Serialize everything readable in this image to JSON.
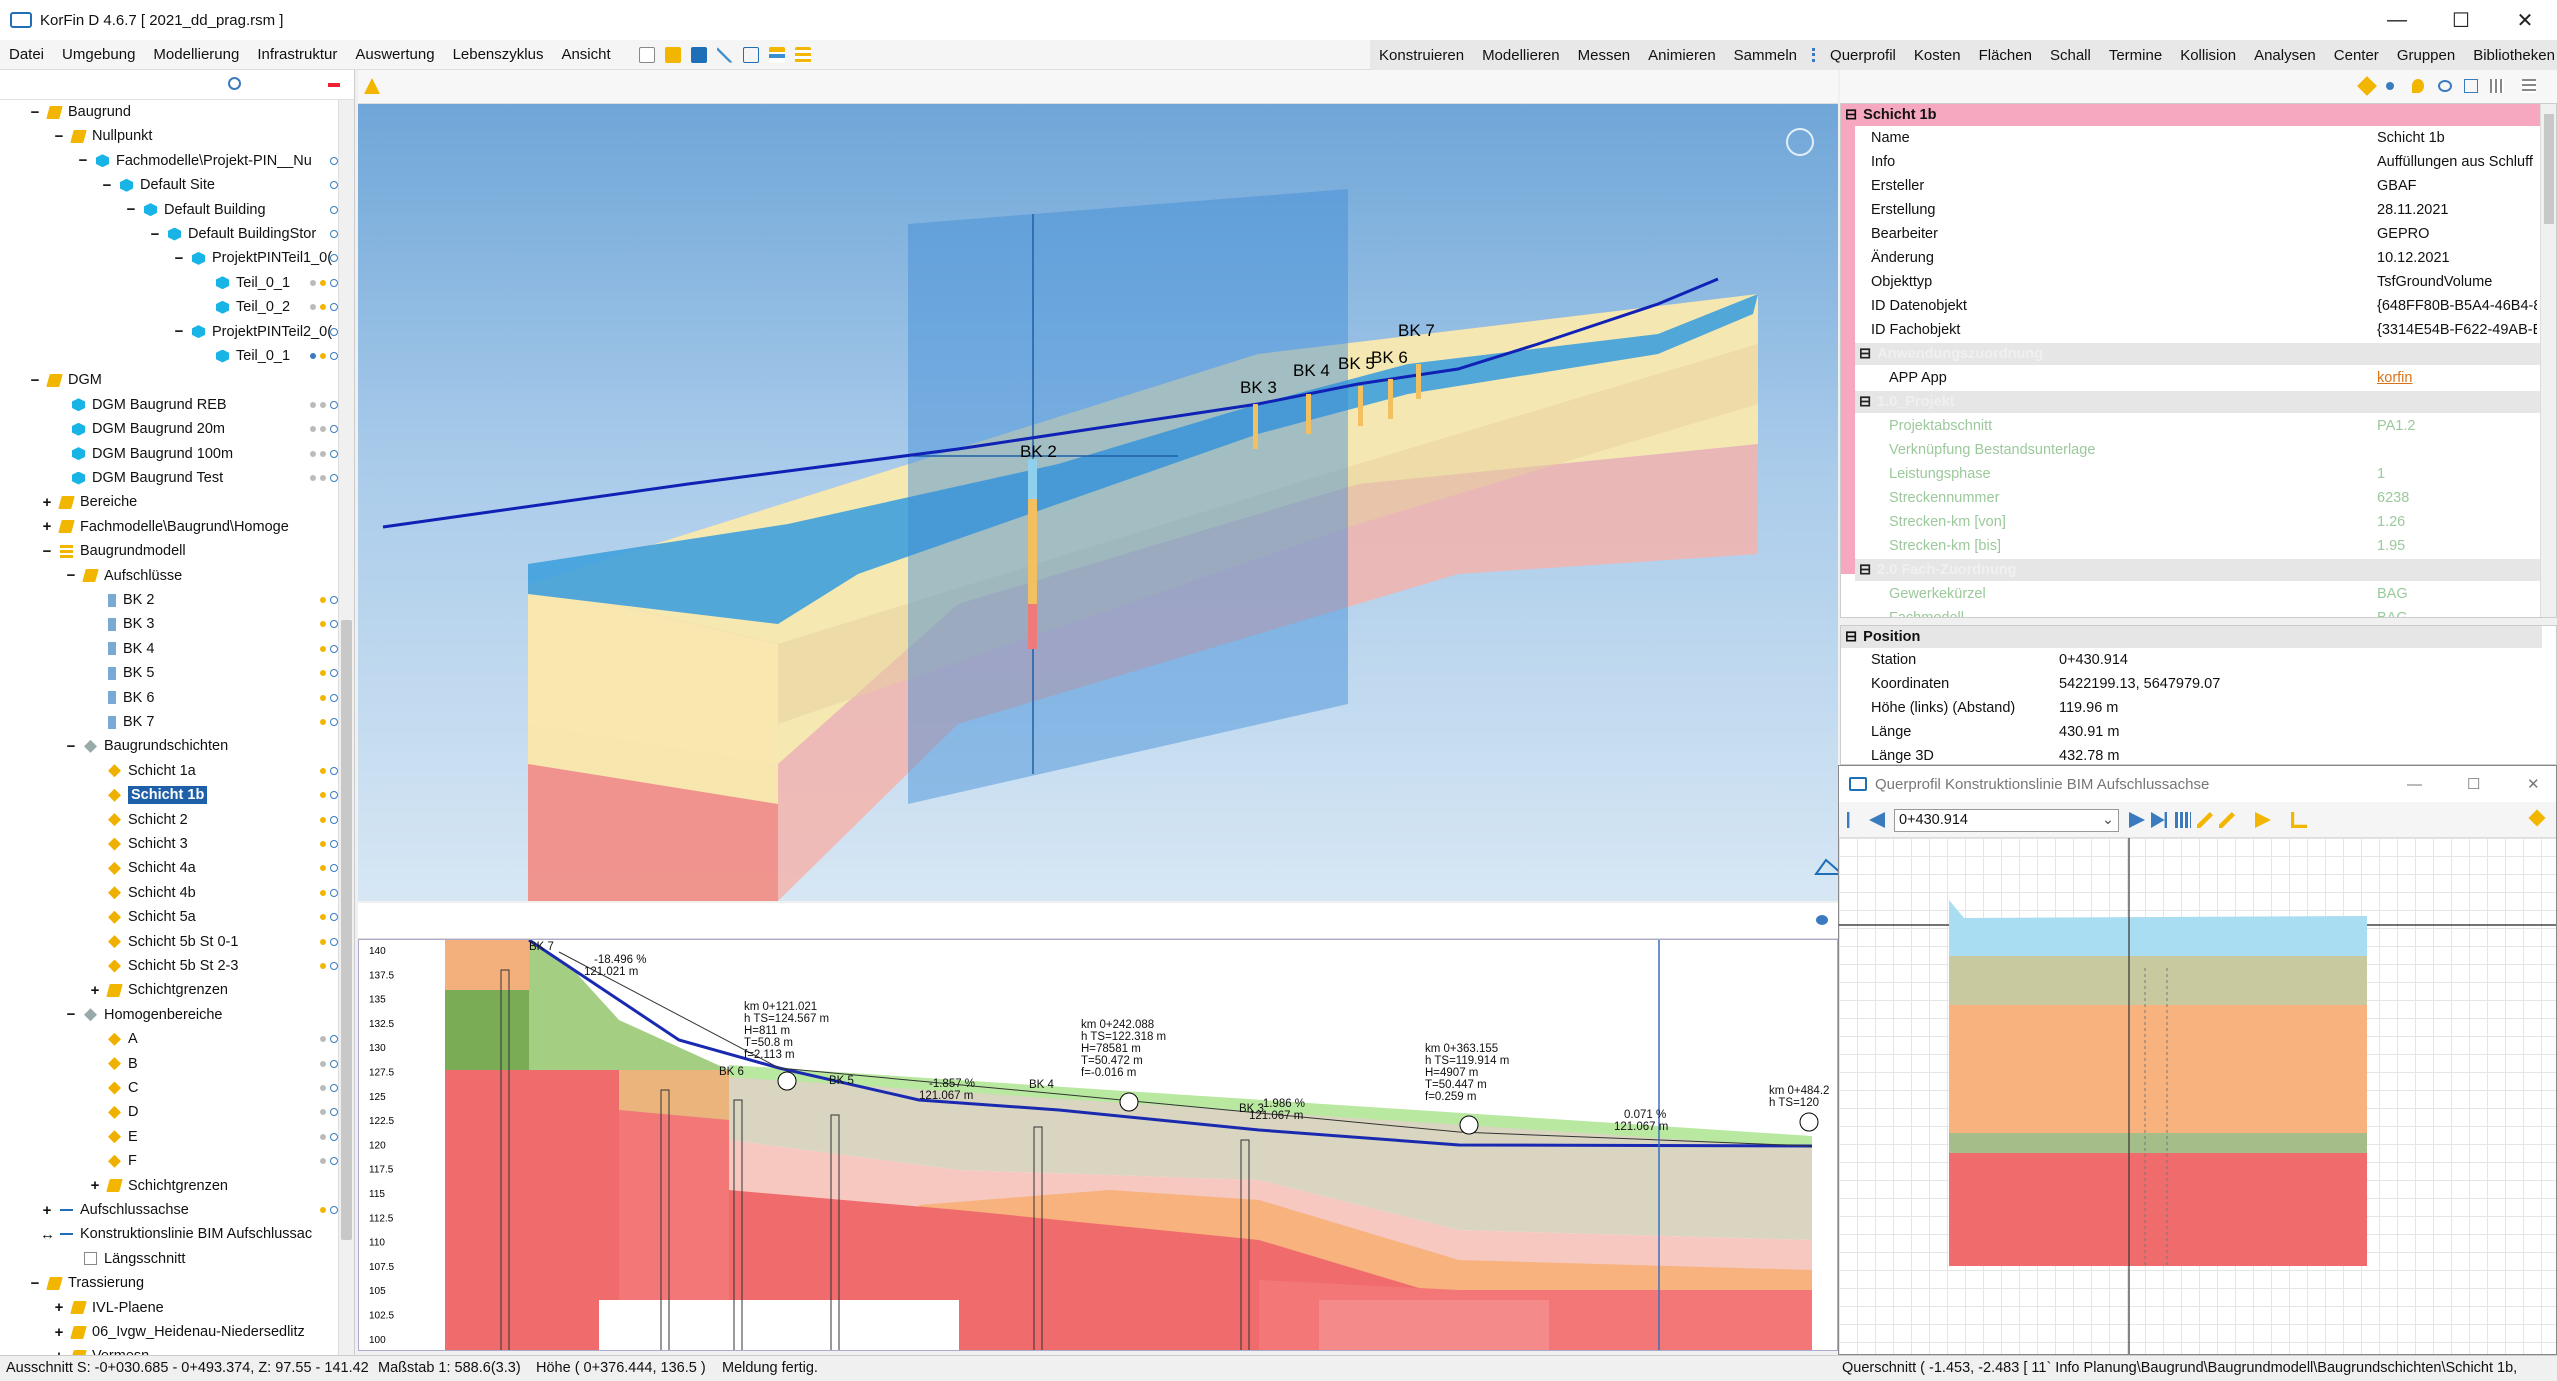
{
  "window": {
    "title": "KorFin D 4.6.7 [ 2021_dd_prag.rsm ]"
  },
  "menu": {
    "left": [
      "Datei",
      "Umgebung",
      "Modellierung",
      "Infrastruktur",
      "Auswertung",
      "Lebenszyklus",
      "Ansicht"
    ],
    "right": [
      "Konstruieren",
      "Modellieren",
      "Messen",
      "Animieren",
      "Sammeln",
      "Querprofil",
      "Kosten",
      "Flächen",
      "Schall",
      "Termine",
      "Kollision",
      "Analysen",
      "Center",
      "Gruppen",
      "Bibliotheken"
    ]
  },
  "tree": [
    {
      "label": "Baugrund",
      "level": 0,
      "exp": "−",
      "icon": "folder"
    },
    {
      "label": "Nullpunkt",
      "level": 1,
      "exp": "−",
      "icon": "folder"
    },
    {
      "label": "Fachmodelle\\Projekt-PIN__Nu",
      "level": 2,
      "exp": "−",
      "icon": "cube",
      "marks": "q"
    },
    {
      "label": "Default Site",
      "level": 3,
      "exp": "−",
      "icon": "cube",
      "marks": "q"
    },
    {
      "label": "Default Building",
      "level": 4,
      "exp": "−",
      "icon": "cube",
      "marks": "q"
    },
    {
      "label": "Default BuildingStor",
      "level": 5,
      "exp": "−",
      "icon": "cube",
      "marks": "q"
    },
    {
      "label": "ProjektPINTeil1_0(",
      "level": 6,
      "exp": "−",
      "icon": "cube",
      "marks": "q"
    },
    {
      "label": "Teil_0_1",
      "level": 7,
      "exp": "",
      "icon": "cube",
      "marks": "gyq"
    },
    {
      "label": "Teil_0_2",
      "level": 7,
      "exp": "",
      "icon": "cube",
      "marks": "gyq"
    },
    {
      "label": "ProjektPINTeil2_0(",
      "level": 6,
      "exp": "−",
      "icon": "cube",
      "marks": "q"
    },
    {
      "label": "Teil_0_1",
      "level": 7,
      "exp": "",
      "icon": "cube",
      "marks": "byq"
    },
    {
      "label": "DGM",
      "level": 0,
      "exp": "−",
      "icon": "folder"
    },
    {
      "label": "DGM Baugrund REB",
      "level": 1,
      "exp": "",
      "icon": "cube",
      "marks": "ggq"
    },
    {
      "label": "DGM Baugrund 20m",
      "level": 1,
      "exp": "",
      "icon": "cube",
      "marks": "ggq"
    },
    {
      "label": "DGM Baugrund 100m",
      "level": 1,
      "exp": "",
      "icon": "cube",
      "marks": "ggq"
    },
    {
      "label": "DGM Baugrund Test",
      "level": 1,
      "exp": "",
      "icon": "cube",
      "marks": "ggq"
    },
    {
      "label": "Bereiche",
      "level": 0,
      "exp": "+",
      "icon": "folder",
      "pad": 1
    },
    {
      "label": "Fachmodelle\\Baugrund\\Homoge",
      "level": 0,
      "exp": "+",
      "icon": "folder",
      "pad": 1
    },
    {
      "label": "Baugrundmodell",
      "level": 0,
      "exp": "−",
      "icon": "list",
      "pad": 1
    },
    {
      "label": "Aufschlüsse",
      "level": 1,
      "exp": "−",
      "icon": "folder",
      "pad": 1
    },
    {
      "label": "BK 2",
      "level": 2,
      "exp": "",
      "icon": "bore",
      "marks": "yq",
      "pad": 1
    },
    {
      "label": "BK 3",
      "level": 2,
      "exp": "",
      "icon": "bore",
      "marks": "yq",
      "pad": 1
    },
    {
      "label": "BK 4",
      "level": 2,
      "exp": "",
      "icon": "bore",
      "marks": "yq",
      "pad": 1
    },
    {
      "label": "BK 5",
      "level": 2,
      "exp": "",
      "icon": "bore",
      "marks": "yq",
      "pad": 1
    },
    {
      "label": "BK 6",
      "level": 2,
      "exp": "",
      "icon": "bore",
      "marks": "yq",
      "pad": 1
    },
    {
      "label": "BK 7",
      "level": 2,
      "exp": "",
      "icon": "bore",
      "marks": "yq",
      "pad": 1
    },
    {
      "label": "Baugrundschichten",
      "level": 1,
      "exp": "−",
      "icon": "grey",
      "pad": 1
    },
    {
      "label": "Schicht 1a",
      "level": 2,
      "exp": "",
      "icon": "layer",
      "marks": "yq",
      "pad": 1
    },
    {
      "label": "Schicht 1b",
      "level": 2,
      "exp": "",
      "icon": "layer",
      "marks": "yq",
      "pad": 1,
      "selected": true
    },
    {
      "label": "Schicht 2",
      "level": 2,
      "exp": "",
      "icon": "layer",
      "marks": "yq",
      "pad": 1
    },
    {
      "label": "Schicht 3",
      "level": 2,
      "exp": "",
      "icon": "layer",
      "marks": "yq",
      "pad": 1
    },
    {
      "label": "Schicht 4a",
      "level": 2,
      "exp": "",
      "icon": "layer",
      "marks": "yq",
      "pad": 1
    },
    {
      "label": "Schicht 4b",
      "level": 2,
      "exp": "",
      "icon": "layer",
      "marks": "yq",
      "pad": 1
    },
    {
      "label": "Schicht 5a",
      "level": 2,
      "exp": "",
      "icon": "layer",
      "marks": "yq",
      "pad": 1
    },
    {
      "label": "Schicht 5b St 0-1",
      "level": 2,
      "exp": "",
      "icon": "layer",
      "marks": "yq",
      "pad": 1
    },
    {
      "label": "Schicht 5b St 2-3",
      "level": 2,
      "exp": "",
      "icon": "layer",
      "marks": "yq",
      "pad": 1
    },
    {
      "label": "Schichtgrenzen",
      "level": 2,
      "exp": "+",
      "icon": "folder",
      "pad": 1
    },
    {
      "label": "Homogenbereiche",
      "level": 1,
      "exp": "−",
      "icon": "grey",
      "pad": 1
    },
    {
      "label": "A",
      "level": 2,
      "exp": "",
      "icon": "layer",
      "marks": "gq",
      "pad": 1
    },
    {
      "label": "B",
      "level": 2,
      "exp": "",
      "icon": "layer",
      "marks": "gq",
      "pad": 1
    },
    {
      "label": "C",
      "level": 2,
      "exp": "",
      "icon": "layer",
      "marks": "gq",
      "pad": 1
    },
    {
      "label": "D",
      "level": 2,
      "exp": "",
      "icon": "layer",
      "marks": "gq",
      "pad": 1
    },
    {
      "label": "E",
      "level": 2,
      "exp": "",
      "icon": "layer",
      "marks": "gq",
      "pad": 1
    },
    {
      "label": "F",
      "level": 2,
      "exp": "",
      "icon": "layer",
      "marks": "gq",
      "pad": 1
    },
    {
      "label": "Schichtgrenzen",
      "level": 2,
      "exp": "+",
      "icon": "folder",
      "pad": 1
    },
    {
      "label": "Aufschlussachse",
      "level": 0,
      "exp": "+",
      "icon": "axis",
      "marks": "yq",
      "pad": 1
    },
    {
      "label": "Konstruktionslinie BIM Aufschlussac",
      "level": 0,
      "exp": "↔",
      "icon": "axis",
      "pad": 1
    },
    {
      "label": "Längsschnitt",
      "level": 1,
      "exp": "",
      "icon": "file",
      "pad": 1
    },
    {
      "label": "Trassierung",
      "level": 0,
      "exp": "−",
      "icon": "folder"
    },
    {
      "label": "IVL-Plaene",
      "level": 1,
      "exp": "+",
      "icon": "folder"
    },
    {
      "label": "06_Ivgw_Heidenau-Niedersedlitz",
      "level": 1,
      "exp": "+",
      "icon": "folder"
    },
    {
      "label": "Vermesn",
      "level": 1,
      "exp": "+",
      "icon": "folder"
    }
  ],
  "view3d": {
    "labels": [
      "BK 2",
      "BK 3",
      "BK 4",
      "BK 5",
      "BK 6",
      "BK 7"
    ]
  },
  "props": {
    "header": "Schicht 1b",
    "rows": [
      {
        "k": "Name",
        "v": "Schicht 1b"
      },
      {
        "k": "Info",
        "v": "Auffüllungen aus Schluff"
      },
      {
        "k": "Ersteller",
        "v": "GBAF"
      },
      {
        "k": "Erstellung",
        "v": "28.11.2021"
      },
      {
        "k": "Bearbeiter",
        "v": "GEPRO"
      },
      {
        "k": "Änderung",
        "v": "10.12.2021"
      },
      {
        "k": "Objekttyp",
        "v": "TsfGroundVolume"
      },
      {
        "k": "ID Datenobjekt",
        "v": "{648FF80B-B5A4-46B4-8"
      },
      {
        "k": "ID Fachobjekt",
        "v": "{3314E54B-F622-49AB-B"
      }
    ],
    "sect2": "Anwendungszuordnung",
    "app_key": "APP App",
    "app_val": "korfin",
    "sect3": "1.0_Projekt",
    "subrows": [
      {
        "k": "Projektabschnitt",
        "v": "PA1.2"
      },
      {
        "k": "Verknüpfung Bestandsunterlage",
        "v": ""
      },
      {
        "k": "Leistungsphase",
        "v": "1"
      },
      {
        "k": "Streckennummer",
        "v": "6238"
      },
      {
        "k": "Strecken-km [von]",
        "v": "1.26"
      },
      {
        "k": "Strecken-km [bis]",
        "v": "1.95"
      }
    ],
    "sect4": "2.0 Fach-Zuordnung",
    "subrows2": [
      {
        "k": "Gewerkekürzel",
        "v": "BAG"
      },
      {
        "k": "Fachmodell",
        "v": "BAG"
      }
    ]
  },
  "position": {
    "header": "Position",
    "rows": [
      {
        "k": "Station",
        "v": "0+430.914"
      },
      {
        "k": "Koordinaten",
        "v": "5422199.13, 5647979.07"
      },
      {
        "k": "Höhe (links) (Abstand)",
        "v": "119.96 m"
      },
      {
        "k": "Länge",
        "v": "430.91 m"
      },
      {
        "k": "Länge 3D",
        "v": "432.78 m"
      }
    ]
  },
  "crosswin": {
    "title": "Querprofil Konstruktionslinie BIM Aufschlussachse",
    "station": "0+430.914"
  },
  "profile": {
    "yticks": [
      "140",
      "137.5",
      "135",
      "132.5",
      "130",
      "127.5",
      "125",
      "122.5",
      "120",
      "117.5",
      "115",
      "112.5",
      "110",
      "107.5",
      "105",
      "102.5",
      "100"
    ],
    "bk_labels": [
      "BK 7",
      "BK 6",
      "BK 5",
      "BK 4",
      "BK 3"
    ],
    "slopes": [
      {
        "a": "-18.496 %",
        "b": "121.021 m"
      },
      {
        "a": "-1.857 %",
        "b": "121.067 m"
      },
      {
        "a": "-1.986 %",
        "b": "121.067 m"
      },
      {
        "a": "0.071 %",
        "b": "121.067 m"
      }
    ],
    "annot1": [
      "km 0+121.021",
      "h TS=124.567 m",
      "H=811 m",
      "T=50.8 m",
      "f=2.113 m"
    ],
    "annot2": [
      "km 0+242.088",
      "h TS=122.318 m",
      "H=78581 m",
      "T=50.472 m",
      "f=-0.016 m"
    ],
    "annot3": [
      "km 0+363.155",
      "h TS=119.914 m",
      "H=4907 m",
      "T=50.447 m",
      "f=0.259 m"
    ],
    "annot4": [
      "km 0+484.2",
      "h TS=120"
    ]
  },
  "status": {
    "ausschnitt": "Ausschnitt  S: -0+030.685 - 0+493.374, Z: 97.55 - 141.42",
    "massstab": "Maßstab  1: 588.6(3.3)",
    "hoehe": "Höhe  ( 0+376.444, 136.5 )",
    "meldung": "Meldung  fertig.",
    "quer": "Querschnitt  ( -1.453, -2.483 [ 11`  Info  Planung\\Baugrund\\Baugrundmodell\\Baugrundschichten\\Schicht 1b,"
  },
  "colors": {
    "accent": "#1d5fa8",
    "pink": "#f5a8c0",
    "water": "#4fa9df"
  }
}
